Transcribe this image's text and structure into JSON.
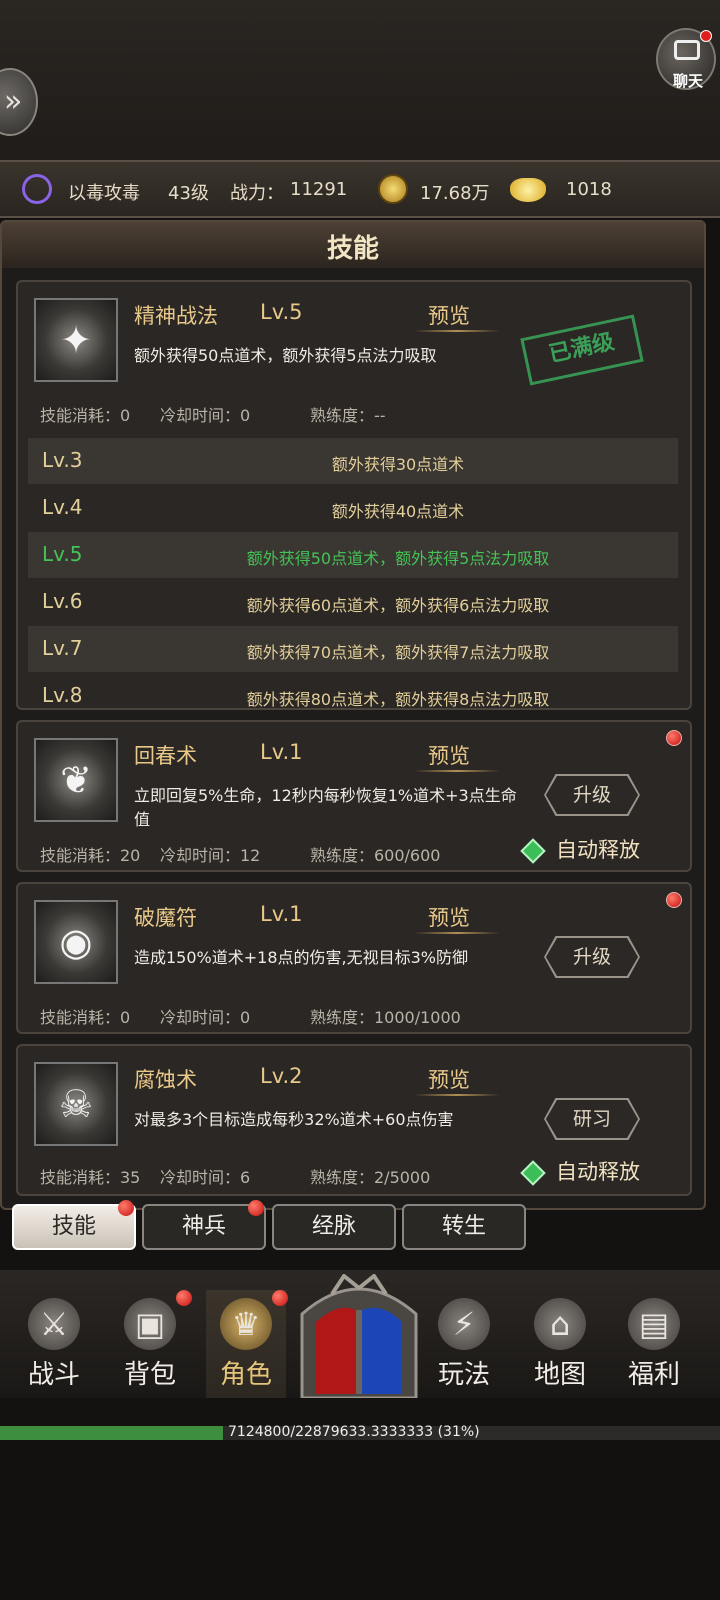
{
  "header": {
    "chat_label": "聊天",
    "player_name": "以毒攻毒",
    "level": "43级",
    "power_label": "战力：",
    "power_value": "11291",
    "gold": "17.68万",
    "ingot": "1018"
  },
  "panel": {
    "title": "技能"
  },
  "skill_main": {
    "name": "精神战法",
    "level": "Lv.5",
    "preview": "预览",
    "desc": "额外获得50点道术，额外获得5点法力吸取",
    "stamp": "已满级",
    "cost": "技能消耗：0",
    "cooldown": "冷却时间：0",
    "proficiency": "熟练度：--",
    "levels": [
      {
        "lv": "Lv.3",
        "text": "额外获得30点道术"
      },
      {
        "lv": "Lv.4",
        "text": "额外获得40点道术"
      },
      {
        "lv": "Lv.5",
        "text": "额外获得50点道术，额外获得5点法力吸取"
      },
      {
        "lv": "Lv.6",
        "text": "额外获得60点道术，额外获得6点法力吸取"
      },
      {
        "lv": "Lv.7",
        "text": "额外获得70点道术，额外获得7点法力吸取"
      },
      {
        "lv": "Lv.8",
        "text": "额外获得80点道术，额外获得8点法力吸取"
      }
    ]
  },
  "skills": [
    {
      "name": "回春术",
      "level": "Lv.1",
      "preview": "预览",
      "desc": "立即回复5%生命，12秒内每秒恢复1%道术+3点生命值",
      "button": "升级",
      "auto": "自动释放",
      "cost": "技能消耗：20",
      "cooldown": "冷却时间：12",
      "proficiency": "熟练度：600/600"
    },
    {
      "name": "破魔符",
      "level": "Lv.1",
      "preview": "预览",
      "desc": "造成150%道术+18点的伤害,无视目标3%防御",
      "button": "升级",
      "cost": "技能消耗：0",
      "cooldown": "冷却时间：0",
      "proficiency": "熟练度：1000/1000"
    },
    {
      "name": "腐蚀术",
      "level": "Lv.2",
      "preview": "预览",
      "desc": "对最多3个目标造成每秒32%道术+60点伤害",
      "button": "研习",
      "auto": "自动释放",
      "cost": "技能消耗：35",
      "cooldown": "冷却时间：6",
      "proficiency": "熟练度：2/5000"
    }
  ],
  "tabs": [
    "技能",
    "神兵",
    "经脉",
    "转生"
  ],
  "nav": [
    "战斗",
    "背包",
    "角色",
    "玩法",
    "地图",
    "福利"
  ],
  "xp": {
    "text": "7124800/22879633.3333333 (31%)",
    "percent": 31
  },
  "colors": {
    "accent_gold": "#e9c98a",
    "active_green": "#45c256",
    "badge_red": "#c40f10"
  },
  "icons": [
    "side-arrow-icon",
    "chat-icon",
    "poison-icon",
    "gold-coin-icon",
    "ingot-icon",
    "battle-icon",
    "bag-icon",
    "character-icon",
    "gameplay-icon",
    "map-icon",
    "welfare-icon"
  ]
}
